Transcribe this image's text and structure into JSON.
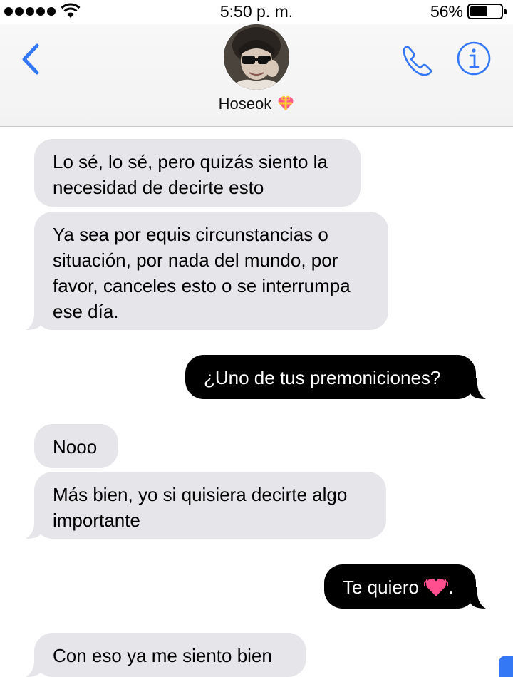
{
  "status_bar": {
    "time": "5:50 p. m.",
    "battery_percent": "56%",
    "battery_level": 0.56,
    "signal_dots": 5
  },
  "header": {
    "contact_name": "Hoseok",
    "contact_emoji": "gift-heart-icon",
    "back_icon": "chevron-left-icon",
    "phone_icon": "phone-icon",
    "info_icon": "info-icon"
  },
  "messages": [
    {
      "direction": "incoming",
      "lines": [
        "Lo sé, lo sé, pero quizás siento la",
        "necesidad de decirte esto"
      ]
    },
    {
      "direction": "incoming",
      "lines": [
        "Ya sea por equis circunstancias o",
        "situación, por nada del mundo, por",
        "favor, canceles esto o se interrumpa",
        "ese día."
      ]
    },
    {
      "direction": "outgoing",
      "lines": [
        "¿Uno de tus premoniciones?"
      ]
    },
    {
      "direction": "incoming",
      "lines": [
        "Nooo"
      ]
    },
    {
      "direction": "incoming",
      "lines": [
        "Más bien, yo si quisiera decirte algo",
        "importante"
      ]
    },
    {
      "direction": "outgoing",
      "text_before": "Te quiero",
      "emoji": "pink-heart-icon",
      "text_after": "."
    },
    {
      "direction": "incoming",
      "lines": [
        "Con eso ya me siento bien"
      ]
    }
  ],
  "colors": {
    "accent": "#3478f6",
    "incoming_bubble": "#e5e5ea",
    "outgoing_bubble": "#000000"
  }
}
